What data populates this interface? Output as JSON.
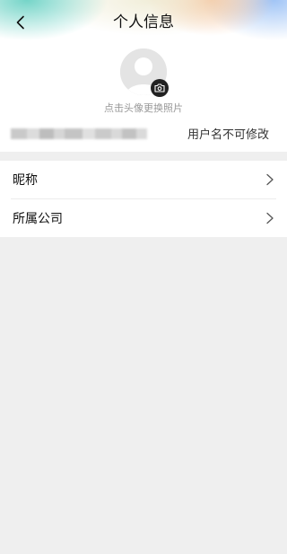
{
  "header": {
    "title": "个人信息",
    "back_icon": "chevron-left-icon"
  },
  "profile": {
    "avatar_hint": "点击头像更换照片",
    "camera_icon": "camera-icon",
    "username_note": "用户名不可修改"
  },
  "list": {
    "items": [
      {
        "label": "昵称",
        "chevron_icon": "chevron-right-icon"
      },
      {
        "label": "所属公司",
        "chevron_icon": "chevron-right-icon"
      }
    ]
  },
  "colors": {
    "background": "#efefef",
    "card": "#ffffff",
    "text_primary": "#111111",
    "text_secondary": "#999999"
  }
}
